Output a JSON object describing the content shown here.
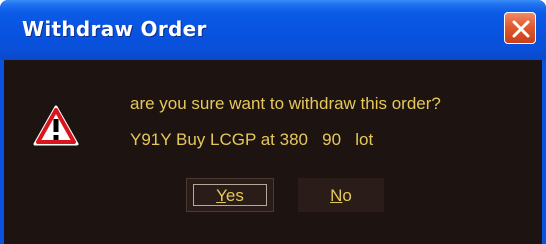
{
  "dialog": {
    "title": "Withdraw Order",
    "message_line1": "are you sure want to withdraw this order?",
    "message_line2": "Y91Y Buy LCGP at 380   90   lot",
    "icon": "warning-icon",
    "close_icon": "close-icon"
  },
  "buttons": {
    "yes": {
      "mnemonic": "Y",
      "rest": "es"
    },
    "no": {
      "mnemonic": "N",
      "rest": "o"
    }
  },
  "colors": {
    "titlebar": "#0852df",
    "body_bg": "#1d1311",
    "text": "#e6c85a",
    "close_red": "#e25a2e",
    "warning_red": "#d8141c"
  }
}
